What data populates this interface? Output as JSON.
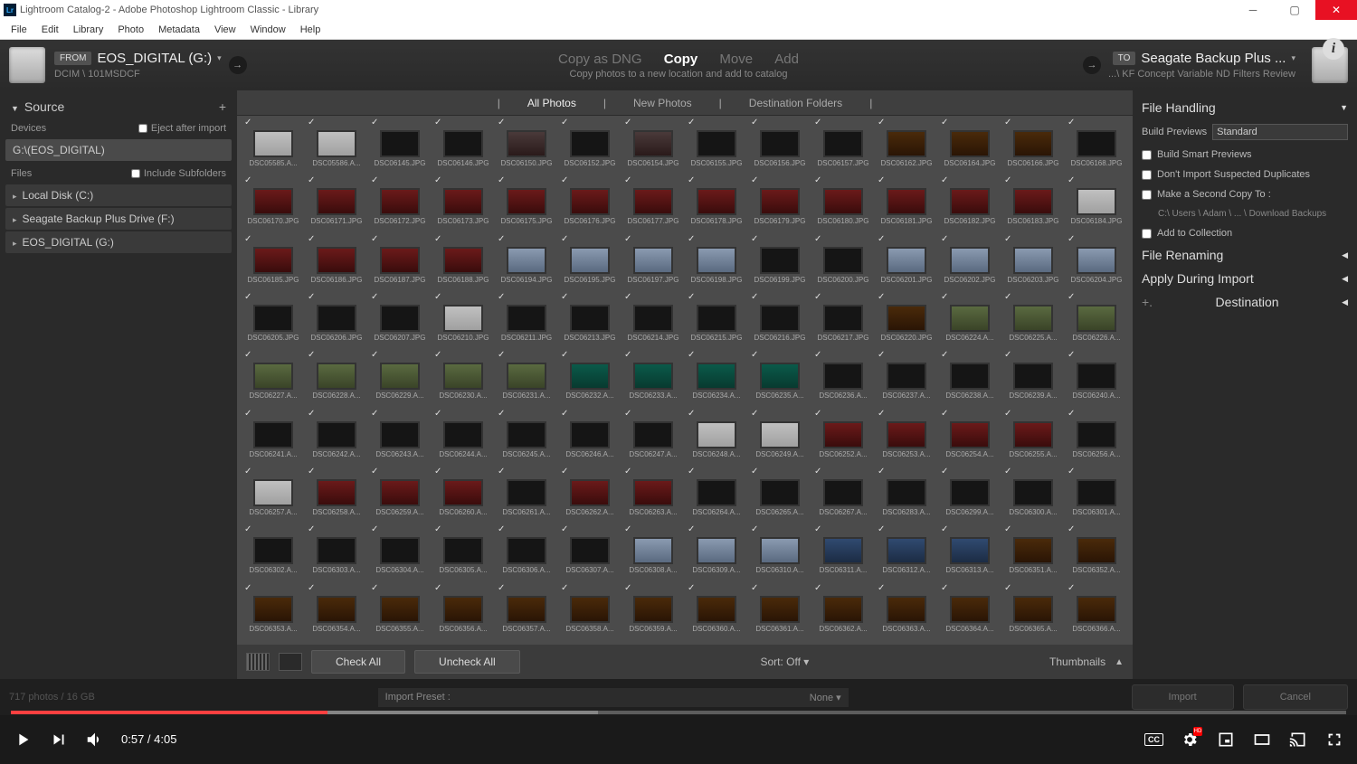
{
  "window": {
    "title": "Lightroom Catalog-2 - Adobe Photoshop Lightroom Classic - Library",
    "icon_text": "Lr"
  },
  "menubar": [
    "File",
    "Edit",
    "Library",
    "Photo",
    "Metadata",
    "View",
    "Window",
    "Help"
  ],
  "header": {
    "from_tag": "FROM",
    "from_title": "EOS_DIGITAL (G:)",
    "from_path": "DCIM \\ 101MSDCF",
    "modes": {
      "dng": "Copy as DNG",
      "copy": "Copy",
      "move": "Move",
      "add": "Add"
    },
    "mode_sub": "Copy photos to a new location and add to catalog",
    "to_tag": "TO",
    "to_title": "Seagate Backup Plus ...",
    "to_path": "...\\ KF Concept Variable ND Filters Review"
  },
  "left": {
    "source_title": "Source",
    "devices_label": "Devices",
    "eject_label": "Eject after import",
    "device_item": "G:\\(EOS_DIGITAL)",
    "files_label": "Files",
    "include_sub_label": "Include Subfolders",
    "drives": [
      "Local Disk (C:)",
      "Seagate Backup Plus Drive (F:)",
      "EOS_DIGITAL (G:)"
    ]
  },
  "center": {
    "tabs": {
      "all": "All Photos",
      "new": "New Photos",
      "dest": "Destination Folders"
    },
    "check_all": "Check All",
    "uncheck_all": "Uncheck All",
    "sort_label": "Sort:",
    "sort_value": "Off",
    "thumbnails_label": "Thumbnails",
    "filenames": [
      "DSC05585.A...",
      "DSC05586.A...",
      "DSC06145.JPG",
      "DSC06146.JPG",
      "DSC06150.JPG",
      "DSC06152.JPG",
      "DSC06154.JPG",
      "DSC06155.JPG",
      "DSC06156.JPG",
      "DSC06157.JPG",
      "DSC06162.JPG",
      "DSC06164.JPG",
      "DSC06166.JPG",
      "DSC06168.JPG",
      "DSC06170.JPG",
      "DSC06171.JPG",
      "DSC06172.JPG",
      "DSC06173.JPG",
      "DSC06175.JPG",
      "DSC06176.JPG",
      "DSC06177.JPG",
      "DSC06178.JPG",
      "DSC06179.JPG",
      "DSC06180.JPG",
      "DSC06181.JPG",
      "DSC06182.JPG",
      "DSC06183.JPG",
      "DSC06184.JPG",
      "DSC06185.JPG",
      "DSC06186.JPG",
      "DSC06187.JPG",
      "DSC06188.JPG",
      "DSC06194.JPG",
      "DSC06195.JPG",
      "DSC06197.JPG",
      "DSC06198.JPG",
      "DSC06199.JPG",
      "DSC06200.JPG",
      "DSC06201.JPG",
      "DSC06202.JPG",
      "DSC06203.JPG",
      "DSC06204.JPG",
      "DSC06205.JPG",
      "DSC06206.JPG",
      "DSC06207.JPG",
      "DSC06210.JPG",
      "DSC06211.JPG",
      "DSC06213.JPG",
      "DSC06214.JPG",
      "DSC06215.JPG",
      "DSC06216.JPG",
      "DSC06217.JPG",
      "DSC06220.JPG",
      "DSC06224.A...",
      "DSC06225.A...",
      "DSC06226.A...",
      "DSC06227.A...",
      "DSC06228.A...",
      "DSC06229.A...",
      "DSC06230.A...",
      "DSC06231.A...",
      "DSC06232.A...",
      "DSC06233.A...",
      "DSC06234.A...",
      "DSC06235.A...",
      "DSC06236.A...",
      "DSC06237.A...",
      "DSC06238.A...",
      "DSC06239.A...",
      "DSC06240.A...",
      "DSC06241.A...",
      "DSC06242.A...",
      "DSC06243.A...",
      "DSC06244.A...",
      "DSC06245.A...",
      "DSC06246.A...",
      "DSC06247.A...",
      "DSC06248.A...",
      "DSC06249.A...",
      "DSC06252.A...",
      "DSC06253.A...",
      "DSC06254.A...",
      "DSC06255.A...",
      "DSC06256.A...",
      "DSC06257.A...",
      "DSC06258.A...",
      "DSC06259.A...",
      "DSC06260.A...",
      "DSC06261.A...",
      "DSC06262.A...",
      "DSC06263.A...",
      "DSC06264.A...",
      "DSC06265.A...",
      "DSC06267.A...",
      "DSC06283.A...",
      "DSC06299.A...",
      "DSC06300.A...",
      "DSC06301.A...",
      "DSC06302.A...",
      "DSC06303.A...",
      "DSC06304.A...",
      "DSC06305.A...",
      "DSC06306.A...",
      "DSC06307.A...",
      "DSC06308.A...",
      "DSC06309.A...",
      "DSC06310.A...",
      "DSC06311.A...",
      "DSC06312.A...",
      "DSC06313.A...",
      "DSC06351.A...",
      "DSC06352.A...",
      "DSC06353.A...",
      "DSC06354.A...",
      "DSC06355.A...",
      "DSC06356.A...",
      "DSC06357.A...",
      "DSC06358.A...",
      "DSC06359.A...",
      "DSC06360.A...",
      "DSC06361.A...",
      "DSC06362.A...",
      "DSC06363.A...",
      "DSC06364.A...",
      "DSC06365.A...",
      "DSC06366.A..."
    ],
    "thumb_classes": [
      "c-light",
      "c-light",
      "c-dark",
      "c-dark",
      "c-face",
      "c-dark",
      "c-face",
      "c-dark",
      "c-dark",
      "c-dark",
      "c-amber",
      "c-amber",
      "c-amber",
      "c-dark",
      "c-red",
      "c-red",
      "c-red",
      "c-red",
      "c-red",
      "c-red",
      "c-red",
      "c-red",
      "c-red",
      "c-red",
      "c-red",
      "c-red",
      "c-red",
      "c-light",
      "c-red",
      "c-red",
      "c-red",
      "c-red",
      "c-out",
      "c-out",
      "c-out",
      "c-out",
      "c-dark",
      "c-dark",
      "c-out",
      "c-out",
      "c-out",
      "c-out",
      "c-dark",
      "c-dark",
      "c-dark",
      "c-light",
      "c-dark",
      "c-dark",
      "c-dark",
      "c-dark",
      "c-dark",
      "c-dark",
      "c-amber",
      "c-tree",
      "c-tree",
      "c-tree",
      "c-tree",
      "c-tree",
      "c-tree",
      "c-tree",
      "c-tree",
      "c-green",
      "c-green",
      "c-green",
      "c-green",
      "c-dark",
      "c-dark",
      "c-dark",
      "c-dark",
      "c-dark",
      "c-dark",
      "c-dark",
      "c-dark",
      "c-dark",
      "c-dark",
      "c-dark",
      "c-dark",
      "c-light",
      "c-light",
      "c-red",
      "c-red",
      "c-red",
      "c-red",
      "c-dark",
      "c-light",
      "c-red",
      "c-red",
      "c-red",
      "c-dark",
      "c-red",
      "c-red",
      "c-dark",
      "c-dark",
      "c-dark",
      "c-dark",
      "c-dark",
      "c-dark",
      "c-dark",
      "c-dark",
      "c-dark",
      "c-dark",
      "c-dark",
      "c-dark",
      "c-dark",
      "c-out",
      "c-out",
      "c-out",
      "c-blue",
      "c-blue",
      "c-blue",
      "c-amber",
      "c-amber",
      "c-amber",
      "c-amber",
      "c-amber",
      "c-amber",
      "c-amber",
      "c-amber",
      "c-amber",
      "c-amber",
      "c-amber",
      "c-amber",
      "c-amber",
      "c-amber",
      "c-amber",
      "c-amber"
    ]
  },
  "right": {
    "file_handling": "File Handling",
    "build_previews": "Build Previews",
    "build_previews_value": "Standard",
    "smart_previews": "Build Smart Previews",
    "dont_import_dup": "Don't Import Suspected Duplicates",
    "second_copy": "Make a Second Copy To :",
    "second_copy_path": "C:\\ Users \\ Adam \\ ... \\ Download Backups",
    "add_collection": "Add to Collection",
    "file_renaming": "File Renaming",
    "apply_during": "Apply During Import",
    "destination": "Destination"
  },
  "footer": {
    "count_label": "717 photos / 16 GB",
    "preset_label": "Import Preset :",
    "preset_value": "None",
    "import_btn": "Import",
    "cancel_btn": "Cancel"
  },
  "video": {
    "current": "0:57",
    "duration": "4:05",
    "cc": "CC",
    "hd": "HD"
  }
}
